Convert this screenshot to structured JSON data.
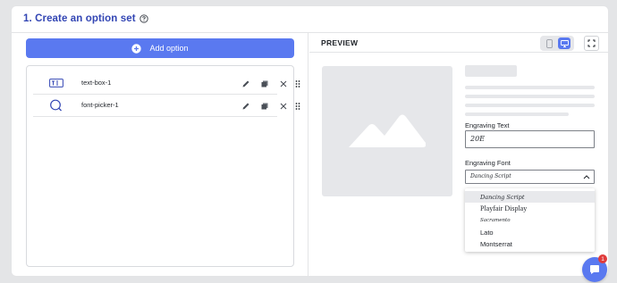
{
  "header": {
    "title": "1. Create an option set",
    "help_icon": "question-circle-icon"
  },
  "left": {
    "add_label": "Add option",
    "add_icon": "plus-circle-icon",
    "options": [
      {
        "name": "text-box-1",
        "icon": "text-box-icon"
      },
      {
        "name": "font-picker-1",
        "icon": "font-picker-icon"
      }
    ]
  },
  "preview": {
    "label": "PREVIEW",
    "device_selected": "desktop",
    "engraving_text_label": "Engraving Text",
    "engraving_text_value": "20E",
    "engraving_font_label": "Engraving Font",
    "engraving_font_value": "Dancing Script",
    "font_options": [
      "Dancing Script",
      "Playfair Display",
      "Sacramento",
      "Lato",
      "Montserrat"
    ]
  },
  "chat": {
    "badge": "1"
  },
  "colors": {
    "accent": "#5a79f0",
    "title": "#3346b4",
    "badge": "#e03b3b"
  }
}
